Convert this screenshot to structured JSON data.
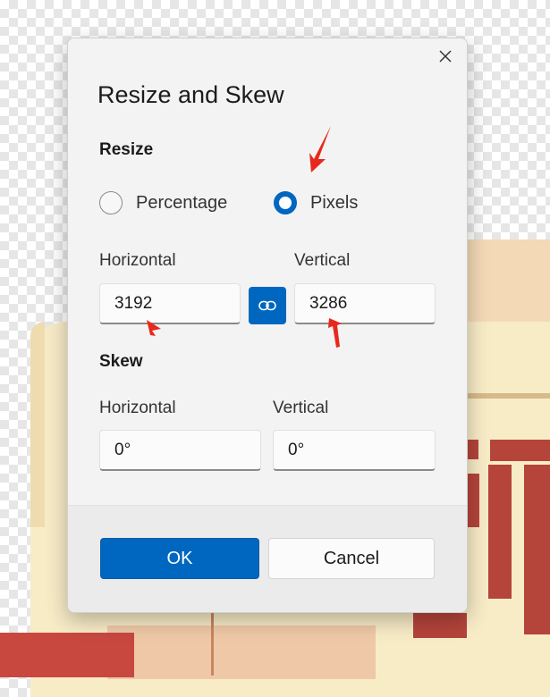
{
  "dialog": {
    "title": "Resize and Skew",
    "resize": {
      "heading": "Resize",
      "mode_options": [
        "Percentage",
        "Pixels"
      ],
      "selected_mode": "Pixels",
      "horizontal_label": "Horizontal",
      "vertical_label": "Vertical",
      "horizontal_value": "3192",
      "vertical_value": "3286",
      "aspect_locked": true
    },
    "skew": {
      "heading": "Skew",
      "horizontal_label": "Horizontal",
      "vertical_label": "Vertical",
      "horizontal_value": "0°",
      "vertical_value": "0°"
    },
    "buttons": {
      "ok": "OK",
      "cancel": "Cancel"
    }
  },
  "colors": {
    "accent": "#0067c0",
    "annotation": "#e8281c",
    "dialog_bg": "#f3f3f3"
  },
  "icons": [
    "close-icon",
    "link-icon"
  ]
}
